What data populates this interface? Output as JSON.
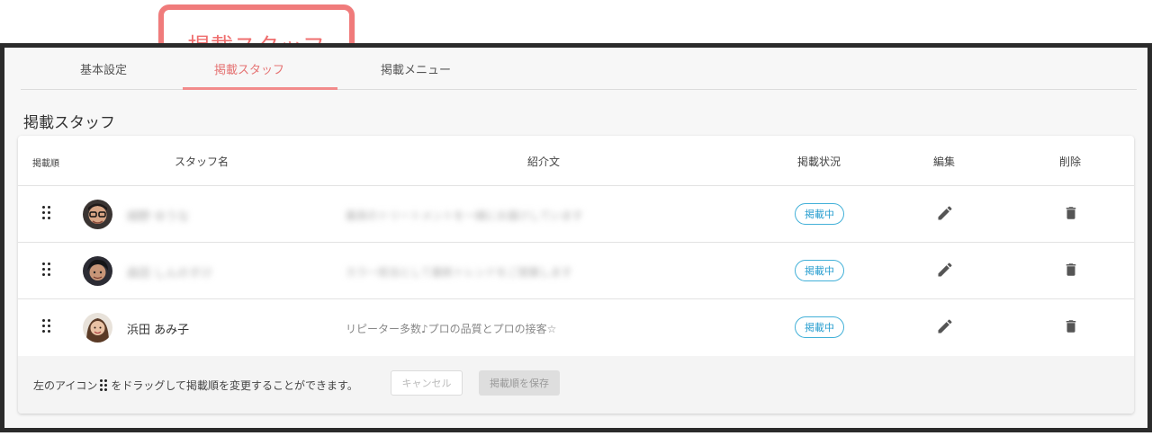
{
  "callout": {
    "label": "掲載スタッフ"
  },
  "tabs": [
    {
      "label": "基本設定"
    },
    {
      "label": "掲載スタッフ"
    },
    {
      "label": "掲載メニュー"
    }
  ],
  "section": {
    "title": "掲載スタッフ"
  },
  "table": {
    "headers": {
      "order": "掲載順",
      "name": "スタッフ名",
      "intro": "紹介文",
      "status": "掲載状況",
      "edit": "編集",
      "delete": "削除"
    },
    "rows": [
      {
        "name": "細野 ゆうな",
        "intro": "最高のトリートメントを一緒にお届けしています",
        "status": "掲載中",
        "blurred": true
      },
      {
        "name": "森田 しんのすけ",
        "intro": "カラー担当として最新トレンドをご提案します",
        "status": "掲載中",
        "blurred": true
      },
      {
        "name": "浜田 あみ子",
        "intro": "リピーター多数♪プロの品質とプロの接客☆",
        "status": "掲載中",
        "blurred": false
      }
    ]
  },
  "footer": {
    "hint_before": "左のアイコン",
    "hint_after": "をドラッグして掲載順を変更することができます。",
    "cancel_label": "キャンセル",
    "save_label": "掲載順を保存"
  },
  "colors": {
    "accent": "#f07b7b",
    "badge": "#2a9fd0"
  },
  "icons": [
    "drag-handle-icon",
    "pencil-icon",
    "trash-icon",
    "avatar"
  ]
}
